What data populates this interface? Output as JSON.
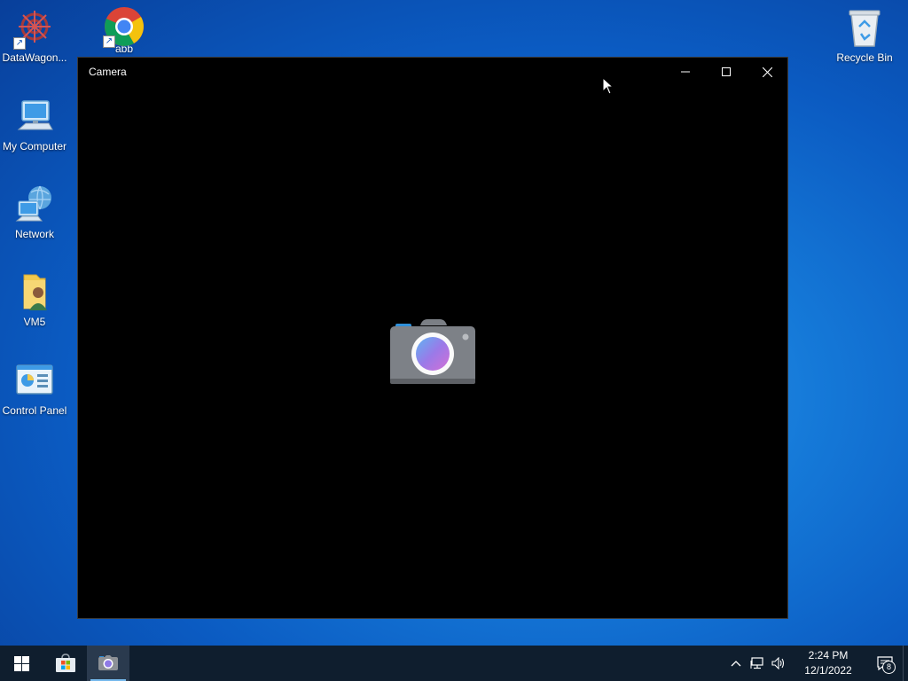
{
  "desktop": {
    "icons": [
      {
        "label": "DataWagon...",
        "icon": "datawagon-icon"
      },
      {
        "label": "abb",
        "icon": "chrome-icon"
      },
      {
        "label": "My Computer",
        "icon": "computer-icon"
      },
      {
        "label": "Network",
        "icon": "network-icon"
      },
      {
        "label": "VM5",
        "icon": "user-folder-icon"
      },
      {
        "label": "Control Panel",
        "icon": "control-panel-icon"
      },
      {
        "label": "Recycle Bin",
        "icon": "recycle-bin-icon"
      }
    ]
  },
  "window": {
    "title": "Camera",
    "controls": {
      "minimize": "minimize-icon",
      "maximize": "maximize-icon",
      "close": "close-icon"
    },
    "background": "#000000"
  },
  "taskbar": {
    "items": [
      {
        "name": "start",
        "icon": "windows-icon"
      },
      {
        "name": "microsoft-store",
        "icon": "store-icon"
      },
      {
        "name": "camera",
        "icon": "camera-icon",
        "active": true
      }
    ],
    "tray": {
      "time": "2:24 PM",
      "date": "12/1/2022",
      "notification_count": "8"
    }
  },
  "colors": {
    "desktop_accent": "#1579d8",
    "taskbar": "#0f1e2e",
    "active_indicator": "#76b9ed"
  }
}
